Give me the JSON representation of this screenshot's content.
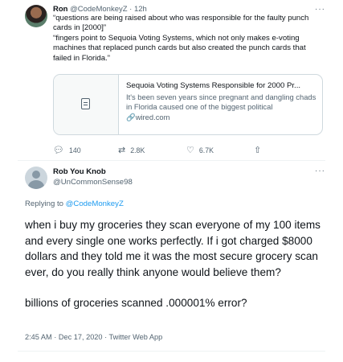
{
  "tweet1": {
    "name": "Ron",
    "handle": "@CodeMonkeyZ",
    "separator": "·",
    "time": "12h",
    "body": "“questions are being raised about who was responsible for the faulty punch cards in [2000]”\n“fingers point to Sequoia Voting Systems, which not only makes e-voting machines that replaced punch cards but also created the punch cards that failed in Florida.”",
    "card": {
      "title": "Sequoia Voting Systems Responsible for 2000 Pr...",
      "description": "It's been seven years since pregnant and dangling chads in Florida caused one of the biggest political",
      "url_icon": "link-icon",
      "url": "wired.com"
    },
    "actions": {
      "reply": {
        "icon": "reply-icon",
        "count": "140"
      },
      "retweet": {
        "icon": "retweet-icon",
        "count": "2.8K"
      },
      "like": {
        "icon": "heart-icon",
        "count": "6.7K"
      },
      "share": {
        "icon": "share-icon"
      }
    }
  },
  "tweet2": {
    "name": "Rob You Knob",
    "handle": "@UnCommonSense98",
    "replying_prefix": "Replying to",
    "replying_to": "@CodeMonkeyZ",
    "paragraph1": "when i buy my groceries they scan everyone of my 100 items and every single one works perfectly. If i got charged $8000 dollars and they told me it was the most secure grocery scan ever, do you really think anyone would believe them?",
    "paragraph2": "billions of groceries scanned .000001% error?",
    "timestamp": "2:45 AM · Dec 17, 2020 · Twitter Web App"
  },
  "more_icon": "···",
  "colors": {
    "link": "#1d9bf0",
    "muted": "#536471",
    "border": "#cfd9de"
  }
}
